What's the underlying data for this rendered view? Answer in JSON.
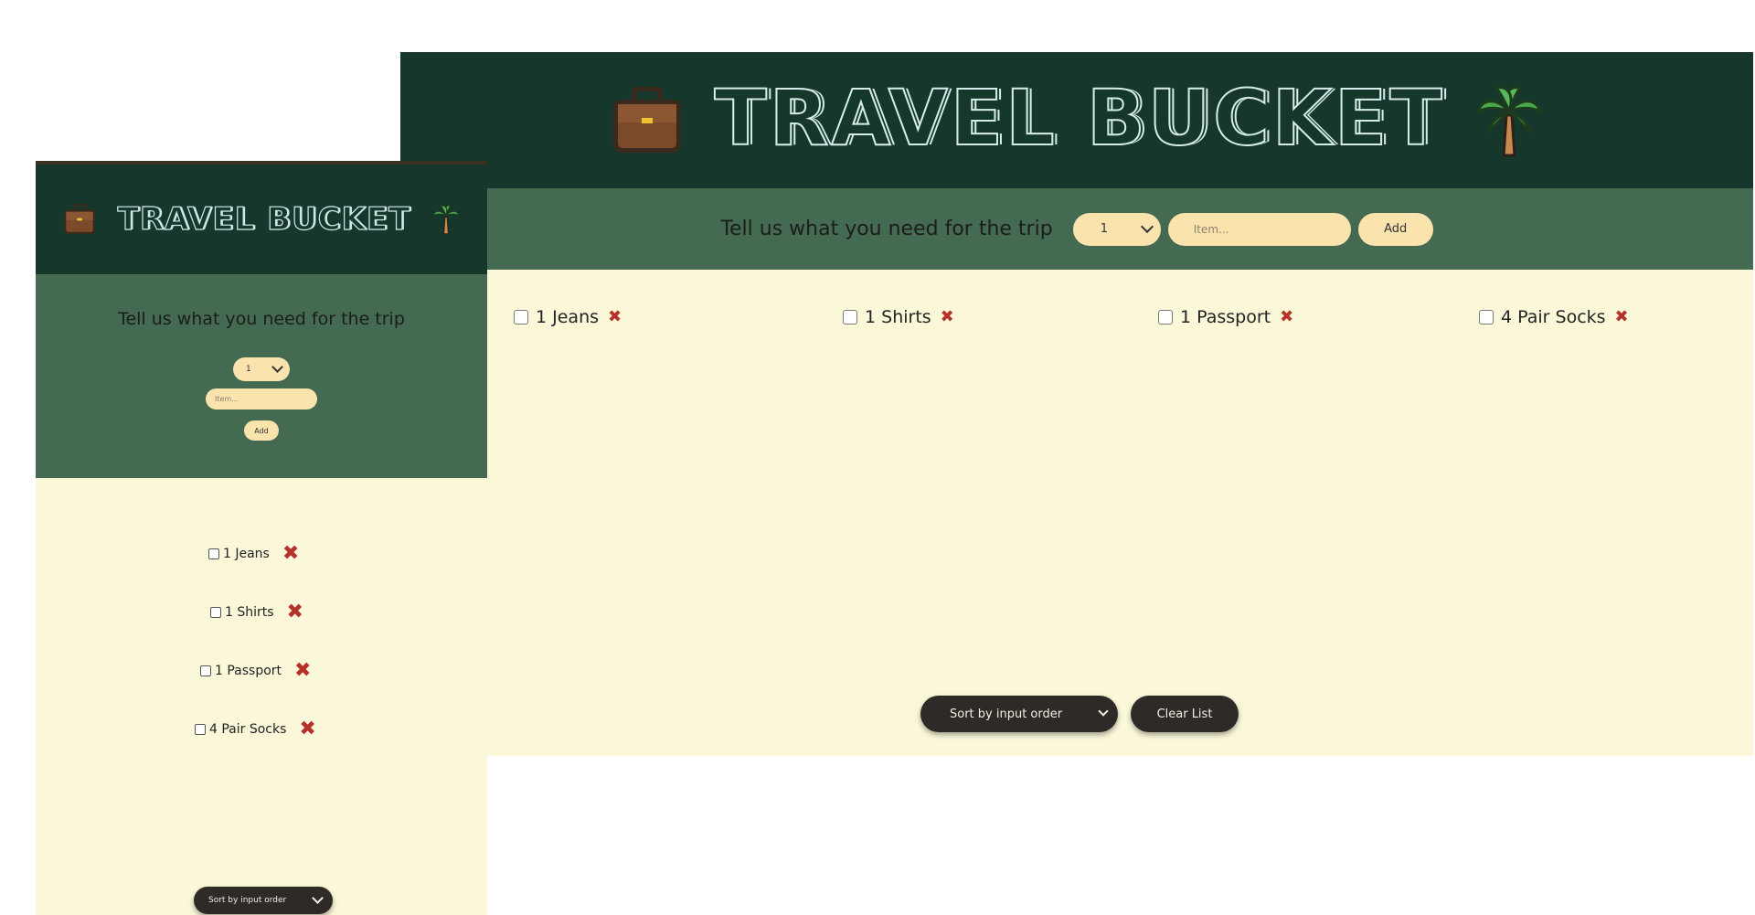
{
  "app": {
    "title": "TRAVEL BUCKET",
    "icons": [
      "briefcase-icon",
      "palm-tree-icon"
    ]
  },
  "form": {
    "prompt": "Tell us what you need for the trip",
    "quantity_value": "1",
    "item_placeholder": "Item...",
    "add_label": "Add"
  },
  "items": [
    {
      "label": "1 Jeans",
      "checked": false
    },
    {
      "label": "1 Shirts",
      "checked": false
    },
    {
      "label": "1 Passport",
      "checked": false
    },
    {
      "label": "4 Pair Socks",
      "checked": false
    }
  ],
  "footer": {
    "sort_value": "Sort by input order",
    "clear_label": "Clear List"
  },
  "colors": {
    "header": "#15372c",
    "form_bar": "#456a52",
    "list_bg": "#fbf8d9",
    "pill": "#fbe3ae",
    "dark_button": "#2e2a27",
    "delete_x": "#b4322a"
  }
}
